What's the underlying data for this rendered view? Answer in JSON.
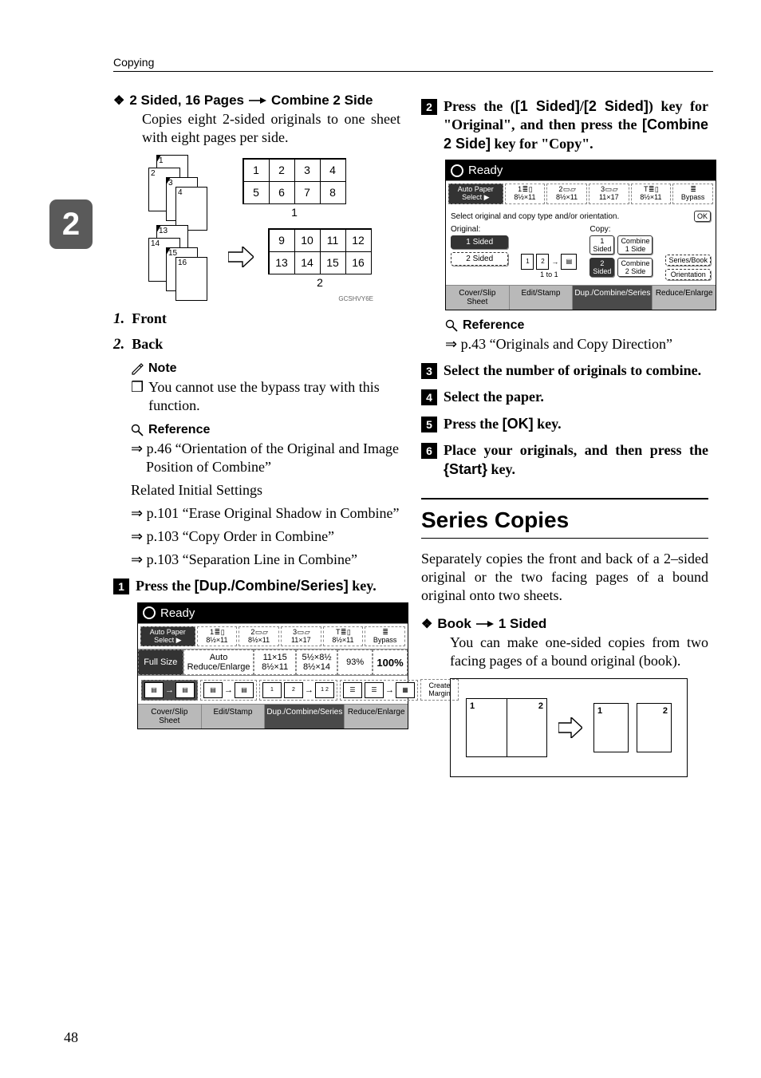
{
  "running_head": "Copying",
  "side_tab": "2",
  "page_number": "48",
  "left": {
    "bullet": {
      "diamond": "❖",
      "pre": "2 Sided, 16 Pages",
      "post": "Combine 2 Side"
    },
    "bullet_body": "Copies eight 2-sided originals to one sheet with eight pages per side.",
    "fig1": {
      "front_stack": [
        "1",
        "2",
        "3",
        "4"
      ],
      "back_stack": [
        "13",
        "14",
        "15",
        "16"
      ],
      "grid_front": [
        "1",
        "2",
        "3",
        "4",
        "5",
        "6",
        "7",
        "8"
      ],
      "grid_back": [
        "9",
        "10",
        "11",
        "12",
        "13",
        "14",
        "15",
        "16"
      ],
      "cap_front": "1",
      "cap_back": "2",
      "code": "GCSHVY6E"
    },
    "ordered": [
      {
        "n": "1.",
        "label": "Front"
      },
      {
        "n": "2.",
        "label": "Back"
      }
    ],
    "note_head": "Note",
    "note_sym": "❒",
    "note_body": "You cannot use the bypass tray with this function.",
    "ref_head": "Reference",
    "refs": [
      "⇒ p.46 “Orientation of the Original and Image Position of Combine”",
      "Related Initial Settings",
      "⇒ p.101 “Erase Original Shadow in Combine”",
      "⇒ p.103 “Copy Order in Combine”",
      "⇒ p.103 “Separation Line in Combine”"
    ],
    "step1": {
      "n": "1",
      "pre": "Press the ",
      "ui": "[Dup./Combine/Series]",
      "post": " key."
    },
    "shot1": {
      "ready": "Ready",
      "left_btn": "Auto Paper Select ▶",
      "trays": [
        {
          "top": "1 ≣ ▯",
          "bot": "8½×11"
        },
        {
          "top": "2 ▭ ▱",
          "bot": "8½×11"
        },
        {
          "top": "3 ▭ ▱",
          "bot": "11×17"
        },
        {
          "top": "T ≣ ▯",
          "bot": "8½×11"
        },
        {
          "top": "≣",
          "bot": "Bypass"
        }
      ],
      "row2_left": "Full Size",
      "row2_auto": "Auto Reduce/Enlarge",
      "row2_r1t": "11×15",
      "row2_r1b": "8½×11",
      "row2_r2t": "5½×8½",
      "row2_r2b": "8½×14",
      "ratio": "93%",
      "hundred": "100%",
      "row3_create": "Create Margin",
      "foot": [
        "Cover/Slip Sheet",
        "Edit/Stamp",
        "Dup./Combine/Series",
        "Reduce/Enlarge"
      ],
      "foot_sel": 2
    }
  },
  "right": {
    "step2": {
      "n": "2",
      "t1": "Press the (",
      "ui1": "[1 Sided]",
      "slash": "/",
      "ui2": "[2 Sided]",
      "t2": ") key for \"Original\", and then press the ",
      "ui3": "[Combine 2 Side]",
      "t3": " key for \"Copy\"."
    },
    "shot2": {
      "ready": "Ready",
      "left_btn": "Auto Paper Select ▶",
      "trays": [
        {
          "top": "1 ≣ ▯",
          "bot": "8½×11"
        },
        {
          "top": "2 ▭ ▱",
          "bot": "8½×11"
        },
        {
          "top": "3 ▭ ▱",
          "bot": "11×17"
        },
        {
          "top": "T ≣ ▯",
          "bot": "8½×11"
        },
        {
          "top": "≣",
          "bot": "Bypass"
        }
      ],
      "line": "Select original and copy type and/or orientation.",
      "ok": "OK",
      "orig_label": "Original:",
      "copy_label": "Copy:",
      "orig_1s": "1 Sided",
      "orig_2s": "2 Sided",
      "diag_text": "1 to 1",
      "copy_1s": "1 Sided",
      "copy_c1": "Combine 1 Side",
      "copy_2s": "2 Sided",
      "copy_c2": "Combine 2 Side",
      "ser": "Series/Book",
      "ori": "Orientation",
      "foot": [
        "Cover/Slip Sheet",
        "Edit/Stamp",
        "Dup./Combine/Series",
        "Reduce/Enlarge"
      ],
      "foot_sel": 2
    },
    "ref_head": "Reference",
    "ref_item": "⇒ p.43 “Originals and Copy Direction”",
    "step3": {
      "n": "3",
      "text": "Select the number of originals to combine."
    },
    "step4": {
      "n": "4",
      "text": "Select the paper."
    },
    "step5": {
      "n": "5",
      "pre": "Press the ",
      "ui": "[OK]",
      "post": " key."
    },
    "step6": {
      "n": "6",
      "pre": "Place your originals, and then press the ",
      "key": "Start",
      "post": " key."
    },
    "h2": "Series Copies",
    "para": "Separately copies the front and back of a 2–sided original or the two facing pages of a bound original onto two sheets.",
    "bullet": {
      "diamond": "❖",
      "pre": "Book",
      "post": "1 Sided"
    },
    "bullet_body": "You can make one-sided copies from two facing pages of a bound original (book).",
    "bookfig": {
      "p1": "1",
      "p2": "2",
      "s1": "1",
      "s2": "2"
    }
  }
}
